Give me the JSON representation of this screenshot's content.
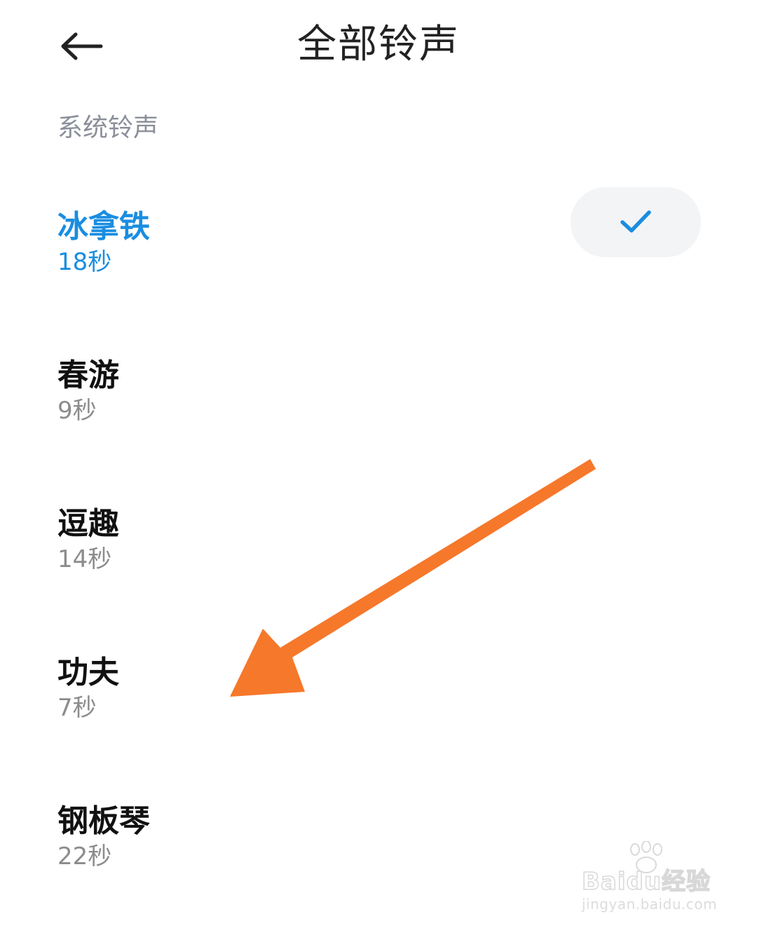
{
  "header": {
    "title": "全部铃声",
    "back_icon": "arrow-left-icon"
  },
  "section": {
    "title": "系统铃声"
  },
  "ringtones": [
    {
      "name": "冰拿铁",
      "duration": "18秒",
      "selected": true
    },
    {
      "name": "春游",
      "duration": "9秒",
      "selected": false
    },
    {
      "name": "逗趣",
      "duration": "14秒",
      "selected": false
    },
    {
      "name": "功夫",
      "duration": "7秒",
      "selected": false
    },
    {
      "name": "钢板琴",
      "duration": "22秒",
      "selected": false
    }
  ],
  "colors": {
    "accent": "#1a8de0",
    "annotation_arrow": "#f6782b",
    "section_title": "#8a8f99",
    "check_pill_bg": "#f3f4f6"
  },
  "watermark": {
    "main": "Baidu经验",
    "sub": "jingyan.baidu.com"
  }
}
